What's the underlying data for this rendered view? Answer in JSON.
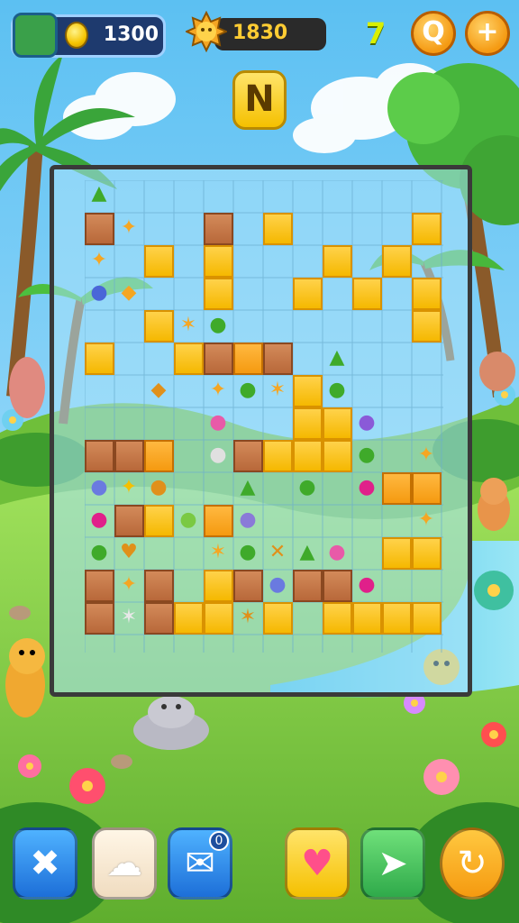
{
  "hud": {
    "coins": "1300",
    "gems": "1830",
    "level": "7",
    "mode_label": "N",
    "help_label": "Q",
    "add_label": "+"
  },
  "toolbar": {
    "notification_count": "0",
    "buttons": [
      "shuffle",
      "hint",
      "chat",
      "favorite",
      "next",
      "undo"
    ]
  },
  "colors": {
    "sky": "#8fd6f5",
    "grass": "#7ac943",
    "gold_block": "#f5b800",
    "brown_block": "#b8683a"
  }
}
